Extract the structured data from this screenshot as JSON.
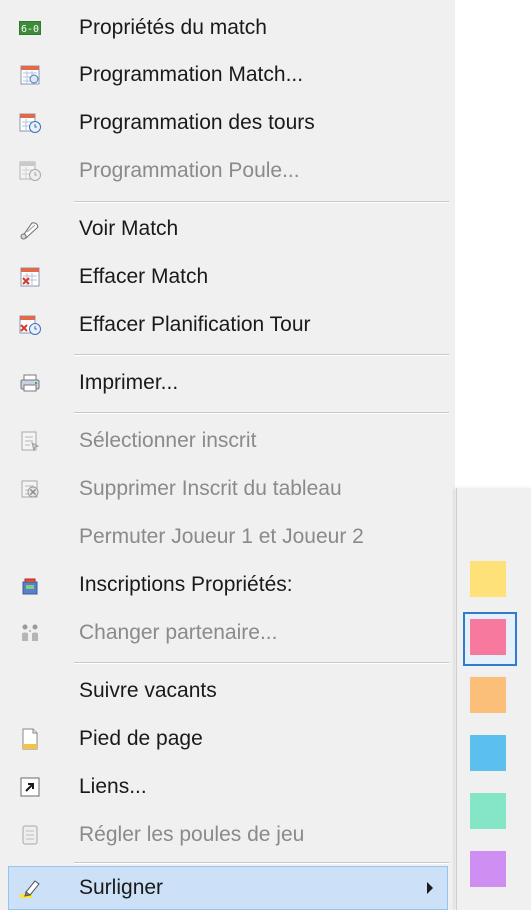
{
  "menu": {
    "items": [
      {
        "label": "Propriétés du match",
        "icon": "score-icon",
        "enabled": true
      },
      {
        "label": "Programmation Match...",
        "icon": "calendar-icon",
        "enabled": true
      },
      {
        "label": "Programmation des tours",
        "icon": "calendar-clock-icon",
        "enabled": true
      },
      {
        "label": "Programmation Poule...",
        "icon": "calendar-clock-gray-icon",
        "enabled": false
      },
      {
        "label": "Voir Match",
        "icon": "shuttlecock-icon",
        "enabled": true
      },
      {
        "label": "Effacer Match",
        "icon": "calendar-delete-icon",
        "enabled": true
      },
      {
        "label": "Effacer Planification Tour",
        "icon": "calendar-delete-clock-icon",
        "enabled": true
      },
      {
        "label": "Imprimer...",
        "icon": "printer-icon",
        "enabled": true
      },
      {
        "label": "Sélectionner inscrit",
        "icon": "select-entry-icon",
        "enabled": false
      },
      {
        "label": "Supprimer Inscrit du tableau",
        "icon": "remove-entry-icon",
        "enabled": false
      },
      {
        "label": "Permuter Joueur 1 et Joueur 2",
        "icon": "",
        "enabled": false
      },
      {
        "label": "Inscriptions Propriétés:",
        "icon": "entries-icon",
        "enabled": true
      },
      {
        "label": "Changer partenaire...",
        "icon": "partner-icon",
        "enabled": false
      },
      {
        "label": "Suivre vacants",
        "icon": "",
        "enabled": true
      },
      {
        "label": "Pied de page",
        "icon": "page-icon",
        "enabled": true
      },
      {
        "label": "Liens...",
        "icon": "link-icon",
        "enabled": true
      },
      {
        "label": "Régler les poules de jeu",
        "icon": "pool-settings-icon",
        "enabled": false
      },
      {
        "label": "Surligner",
        "icon": "highlighter-icon",
        "enabled": true,
        "has_submenu": true
      }
    ]
  },
  "highlight_submenu": {
    "colors": [
      {
        "name": "yellow",
        "hex": "#ffe17a",
        "selected": false
      },
      {
        "name": "pink",
        "hex": "#f7799d",
        "selected": true
      },
      {
        "name": "orange",
        "hex": "#fbbf7a",
        "selected": false
      },
      {
        "name": "blue",
        "hex": "#5cc0ef",
        "selected": false
      },
      {
        "name": "green",
        "hex": "#84e6c6",
        "selected": false
      },
      {
        "name": "purple",
        "hex": "#cf8ff2",
        "selected": false
      }
    ]
  }
}
